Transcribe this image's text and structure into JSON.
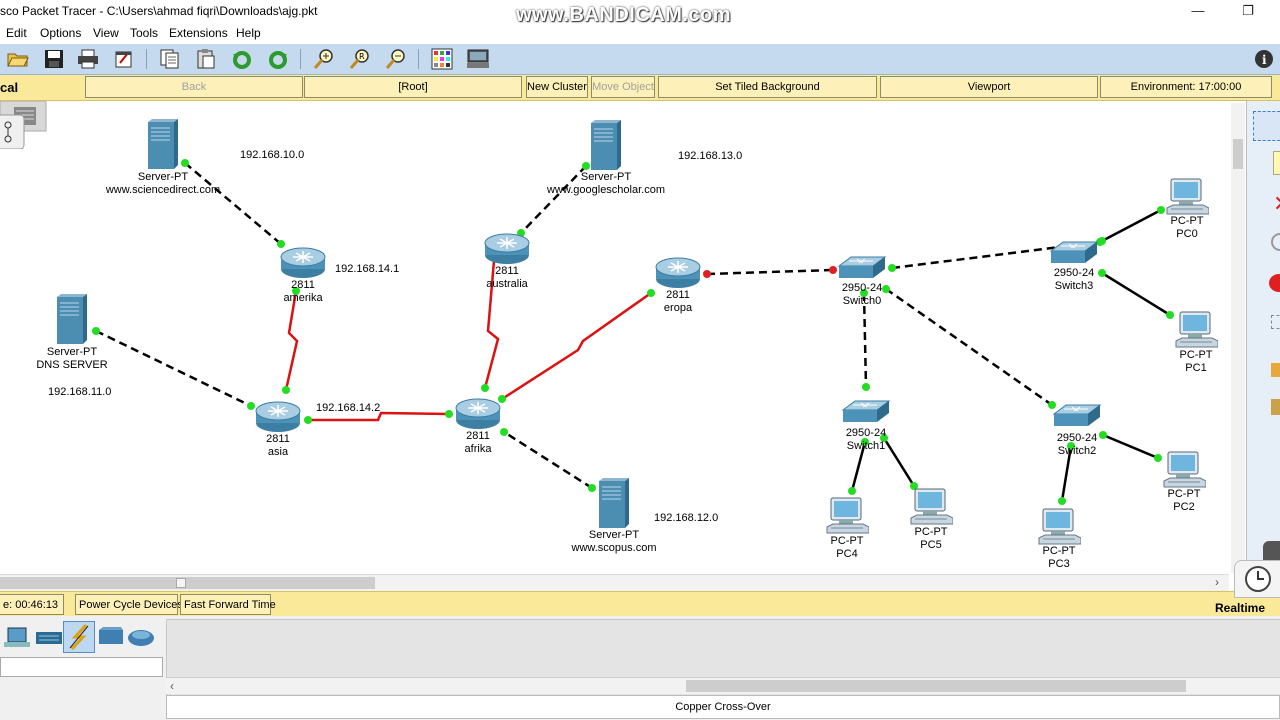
{
  "window": {
    "title": "sco Packet Tracer - C:\\Users\\ahmad fiqri\\Downloads\\ajg.pkt",
    "watermark": "www.BANDICAM.com"
  },
  "menu": [
    "Edit",
    "Options",
    "View",
    "Tools",
    "Extensions",
    "Help"
  ],
  "toolbar_icons": [
    "open-icon",
    "save-icon",
    "print-icon",
    "activity-wizard-icon",
    "copy-icon",
    "paste-icon",
    "undo-icon",
    "redo-icon",
    "zoom-in-icon",
    "zoom-reset-icon",
    "zoom-out-icon",
    "palette-icon",
    "custom-device-icon",
    "info-icon"
  ],
  "logical_bar": {
    "mode_label": "cal",
    "back": "Back",
    "root": "[Root]",
    "new_cluster": "New Cluster",
    "move_object": "Move Object",
    "tiled_background": "Set Tiled Background",
    "viewport": "Viewport",
    "environment": "Environment: 17:00:00"
  },
  "devices": [
    {
      "id": "srv-sciencedirect",
      "type": "server",
      "model": "Server-PT",
      "name": "www.sciencedirect.com"
    },
    {
      "id": "srv-googlescholar",
      "type": "server",
      "model": "Server-PT",
      "name": "www.googlescholar.com"
    },
    {
      "id": "srv-dns",
      "type": "server",
      "model": "Server-PT",
      "name": "DNS SERVER"
    },
    {
      "id": "srv-scopus",
      "type": "server",
      "model": "Server-PT",
      "name": "www.scopus.com"
    },
    {
      "id": "r-amerika",
      "type": "router",
      "model": "2811",
      "name": "amerika"
    },
    {
      "id": "r-australia",
      "type": "router",
      "model": "2811",
      "name": "australia"
    },
    {
      "id": "r-asia",
      "type": "router",
      "model": "2811",
      "name": "asia"
    },
    {
      "id": "r-afrika",
      "type": "router",
      "model": "2811",
      "name": "afrika"
    },
    {
      "id": "r-eropa",
      "type": "router",
      "model": "2811",
      "name": "eropa"
    },
    {
      "id": "sw0",
      "type": "switch",
      "model": "2950-24",
      "name": "Switch0"
    },
    {
      "id": "sw1",
      "type": "switch",
      "model": "2950-24",
      "name": "Switch1"
    },
    {
      "id": "sw2",
      "type": "switch",
      "model": "2950-24",
      "name": "Switch2"
    },
    {
      "id": "sw3",
      "type": "switch",
      "model": "2950-24",
      "name": "Switch3"
    },
    {
      "id": "pc0",
      "type": "pc",
      "model": "PC-PT",
      "name": "PC0"
    },
    {
      "id": "pc1",
      "type": "pc",
      "model": "PC-PT",
      "name": "PC1"
    },
    {
      "id": "pc2",
      "type": "pc",
      "model": "PC-PT",
      "name": "PC2"
    },
    {
      "id": "pc3",
      "type": "pc",
      "model": "PC-PT",
      "name": "PC3"
    },
    {
      "id": "pc4",
      "type": "pc",
      "model": "PC-PT",
      "name": "PC4"
    },
    {
      "id": "pc5",
      "type": "pc",
      "model": "PC-PT",
      "name": "PC5"
    }
  ],
  "links": [
    {
      "from": "srv-sciencedirect",
      "to": "r-amerika",
      "cable": "copper-cross-over",
      "status": [
        "up",
        "up"
      ]
    },
    {
      "from": "srv-googlescholar",
      "to": "r-australia",
      "cable": "copper-cross-over",
      "status": [
        "up",
        "up"
      ]
    },
    {
      "from": "srv-dns",
      "to": "r-asia",
      "cable": "copper-cross-over",
      "status": [
        "up",
        "up"
      ]
    },
    {
      "from": "srv-scopus",
      "to": "r-afrika",
      "cable": "copper-cross-over",
      "status": [
        "up",
        "up"
      ]
    },
    {
      "from": "r-amerika",
      "to": "r-asia",
      "cable": "serial",
      "status": [
        "up",
        "up"
      ]
    },
    {
      "from": "r-australia",
      "to": "r-afrika",
      "cable": "serial",
      "status": [
        "up",
        "up"
      ]
    },
    {
      "from": "r-asia",
      "to": "r-afrika",
      "cable": "serial",
      "status": [
        "up",
        "up"
      ]
    },
    {
      "from": "r-afrika",
      "to": "r-eropa",
      "cable": "serial",
      "status": [
        "up",
        "up"
      ]
    },
    {
      "from": "r-eropa",
      "to": "sw0",
      "cable": "copper-cross-over",
      "status": [
        "down",
        "down"
      ]
    },
    {
      "from": "sw0",
      "to": "sw3",
      "cable": "copper-cross-over",
      "status": [
        "up",
        "up"
      ]
    },
    {
      "from": "sw0",
      "to": "sw1",
      "cable": "copper-cross-over",
      "status": [
        "up",
        "up"
      ]
    },
    {
      "from": "sw0",
      "to": "sw2",
      "cable": "copper-cross-over",
      "status": [
        "up",
        "up"
      ]
    },
    {
      "from": "sw3",
      "to": "pc0",
      "cable": "copper-straight",
      "status": [
        "up",
        "up"
      ]
    },
    {
      "from": "sw3",
      "to": "pc1",
      "cable": "copper-straight",
      "status": [
        "up",
        "up"
      ]
    },
    {
      "from": "sw2",
      "to": "pc2",
      "cable": "copper-straight",
      "status": [
        "up",
        "up"
      ]
    },
    {
      "from": "sw2",
      "to": "pc3",
      "cable": "copper-straight",
      "status": [
        "up",
        "up"
      ]
    },
    {
      "from": "sw1",
      "to": "pc4",
      "cable": "copper-straight",
      "status": [
        "up",
        "up"
      ]
    },
    {
      "from": "sw1",
      "to": "pc5",
      "cable": "copper-straight",
      "status": [
        "up",
        "up"
      ]
    }
  ],
  "network_labels": [
    "192.168.10.0",
    "192.168.13.0",
    "192.168.14.1",
    "192.168.11.0",
    "192.168.14.2",
    "192.168.12.0"
  ],
  "status": {
    "time": "e: 00:46:13",
    "power_cycle": "Power Cycle Devices",
    "fast_forward": "Fast Forward Time",
    "realtime": "Realtime"
  },
  "device_categories": [
    "end-devices-icon",
    "switches-icon",
    "connections-icon",
    "security-icon",
    "wan-emulation-icon"
  ],
  "selected_cable": "Copper Cross-Over",
  "colors": {
    "link_up": "#22dd22",
    "link_down": "#e02020",
    "serial": "#dd1111",
    "toolbar": "#c5d9ef",
    "yellow_bar": "#fbe99a"
  }
}
